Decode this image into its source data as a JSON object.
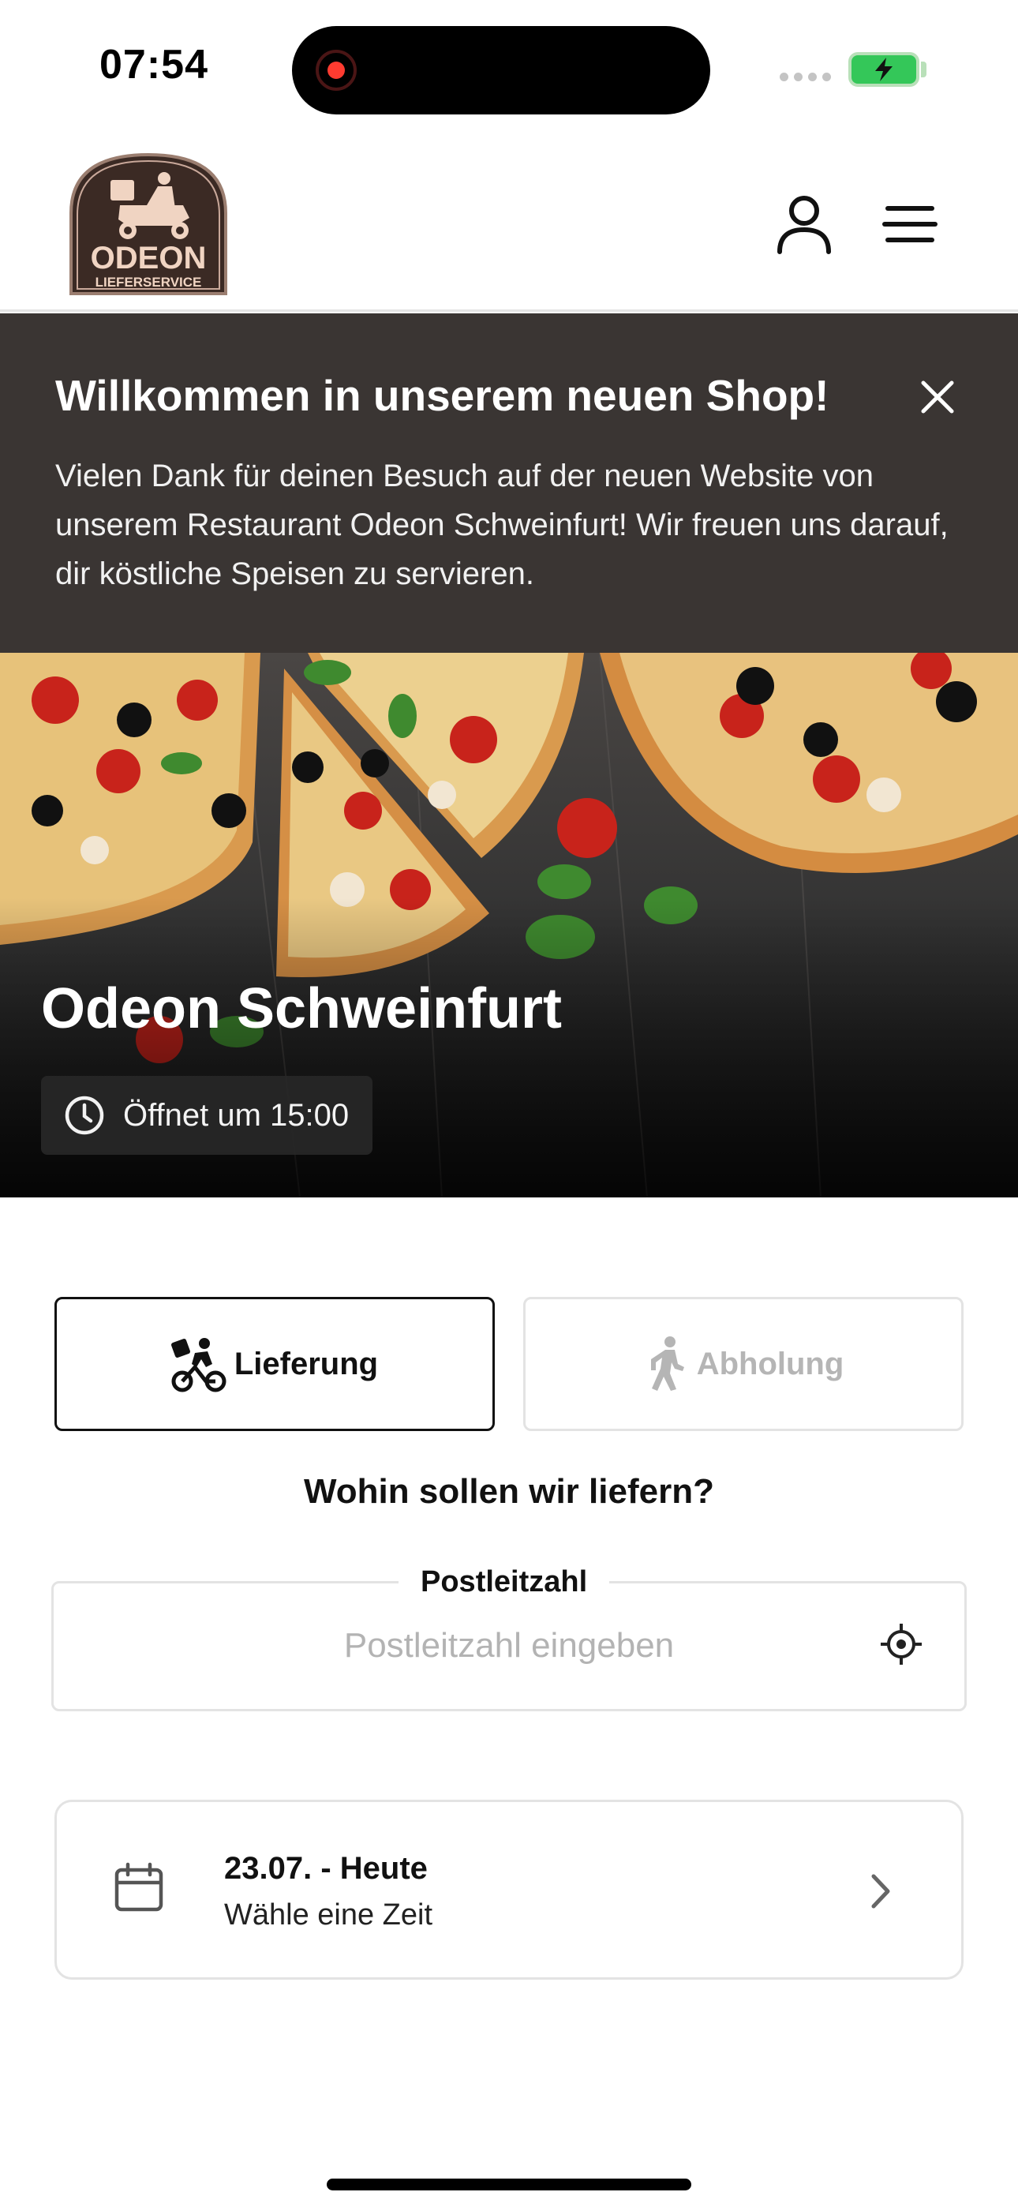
{
  "status_bar": {
    "time": "07:54"
  },
  "header": {
    "logo": {
      "name": "ODEON",
      "subtitle": "LIEFERSERVICE",
      "bg": "#3b2a24",
      "fg": "#f0d4c2"
    },
    "user_icon": "user-icon",
    "menu_icon": "menu-icon"
  },
  "banner": {
    "title": "Willkommen in unserem neuen Shop!",
    "text": "Vielen Dank für deinen Besuch auf der neuen Website von unserem Restaurant Odeon Schweinfurt! Wir freuen uns darauf, dir köstliche Speisen zu servieren.",
    "close_icon": "close-icon",
    "bg": "#3a3533"
  },
  "hero": {
    "title": "Odeon Schweinfurt",
    "hours": "Öffnet um 15:00",
    "clock_icon": "clock-icon"
  },
  "order_mode": {
    "delivery_label": "Lieferung",
    "pickup_label": "Abholung",
    "selected": "Lieferung"
  },
  "delivery": {
    "question": "Wohin sollen wir liefern?",
    "zip_label": "Postleitzahl",
    "zip_placeholder": "Postleitzahl eingeben",
    "zip_value": ""
  },
  "time_select": {
    "date": "23.07. - Heute",
    "subtitle": "Wähle eine Zeit"
  }
}
